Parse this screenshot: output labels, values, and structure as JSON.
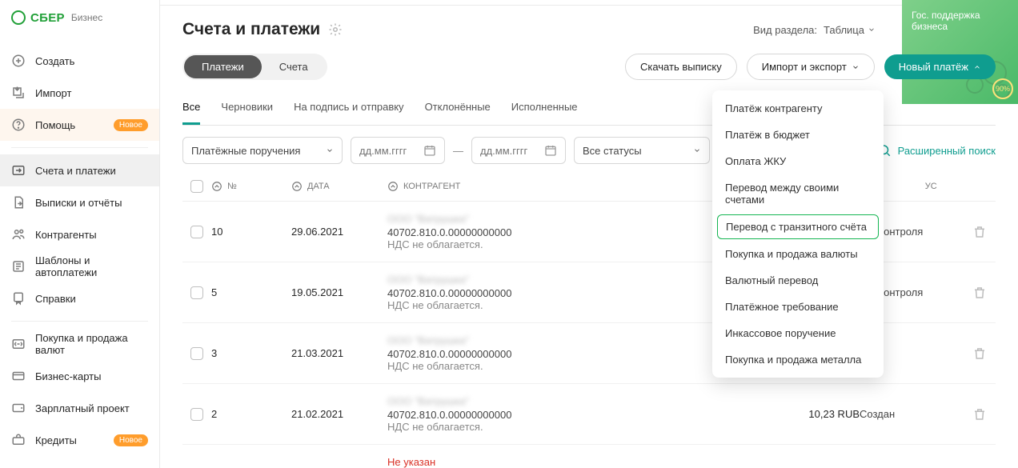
{
  "logo": {
    "brand": "СБЕР",
    "sub": "Бизнес"
  },
  "sidebar": {
    "create": "Создать",
    "import": "Импорт",
    "help": "Помощь",
    "help_badge": "Новое",
    "accounts": "Счета и платежи",
    "statements": "Выписки и отчёты",
    "counterparties": "Контрагенты",
    "templates": "Шаблоны и автоплатежи",
    "refs": "Справки",
    "fx": "Покупка и продажа валют",
    "bcards": "Бизнес-карты",
    "payroll": "Зарплатный проект",
    "credits": "Кредиты",
    "credits_badge": "Новое"
  },
  "title": "Счета и платежи",
  "view_label": "Вид раздела:",
  "view_value": "Таблица",
  "seg": {
    "payments": "Платежи",
    "accounts": "Счета"
  },
  "actions": {
    "download": "Скачать выписку",
    "impexp": "Импорт и экспорт",
    "newpay": "Новый платёж"
  },
  "tabs": [
    "Все",
    "Черновики",
    "На подпись и отправку",
    "Отклонённые",
    "Исполненные"
  ],
  "filters": {
    "type": "Платёжные поручения",
    "date_ph": "дд.мм.гггг",
    "status": "Все статусы",
    "dash": "—",
    "adv": "Расширенный поиск"
  },
  "columns": {
    "num": "№",
    "date": "ДАТА",
    "cp": "КОНТРАГЕНТ",
    "status": "СТАТУС"
  },
  "dropdown": [
    "Платёж контрагенту",
    "Платёж в бюджет",
    "Оплата ЖКУ",
    "Перевод между своими счетами",
    "Перевод с транзитного счёта",
    "Покупка и продажа валюты",
    "Валютный перевод",
    "Платёжное требование",
    "Инкассовое поручение",
    "Покупка и продажа металла"
  ],
  "rows": [
    {
      "num": "10",
      "date": "29.06.2021",
      "cp_blur": "ООО \"Ватрушка\"",
      "acct": "40702.810.0.00000000000",
      "nds": "НДС не облагается.",
      "amt": "",
      "status": "бка контроля"
    },
    {
      "num": "5",
      "date": "19.05.2021",
      "cp_blur": "ООО \"Ватрушка\"",
      "acct": "40702.810.0.00000000000",
      "nds": "НДС не облагается.",
      "amt": "",
      "status": "бка контроля"
    },
    {
      "num": "3",
      "date": "21.03.2021",
      "cp_blur": "ООО \"Ватрушка\"",
      "acct": "40702.810.0.00000000000",
      "nds": "НДС не облагается.",
      "amt": "",
      "status": "дан"
    },
    {
      "num": "2",
      "date": "21.02.2021",
      "cp_blur": "ООО \"Ватрушка\"",
      "acct": "40702.810.0.00000000000",
      "nds": "НДС не облагается.",
      "amt": "10,23 RUB",
      "status": "Создан"
    }
  ],
  "not_specified": "Не указан",
  "promo": {
    "line1": "Гос. поддержка",
    "line2": "бизнеса",
    "pct": "90%"
  }
}
